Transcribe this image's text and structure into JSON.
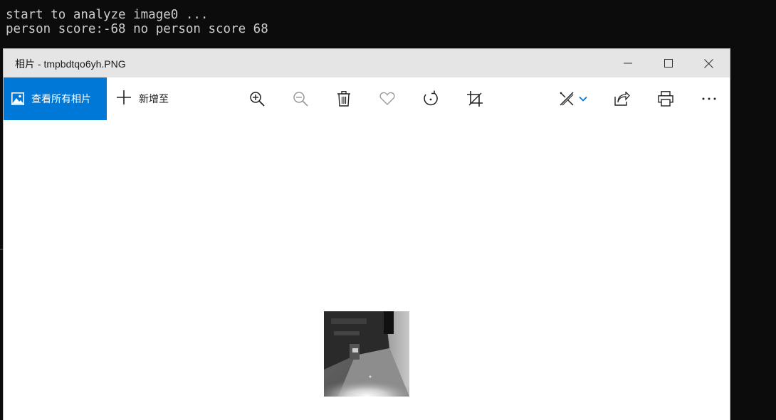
{
  "console": {
    "lines": [
      "start to analyze image0 ...",
      "person score:-68 no person score 68"
    ]
  },
  "window": {
    "title": "相片 - tmpbdtqo6yh.PNG",
    "controls": {
      "minimize_icon": "minimize-icon",
      "maximize_icon": "maximize-icon",
      "close_icon": "close-icon"
    }
  },
  "toolbar": {
    "view_all_label": "查看所有相片",
    "add_to_label": "新增至",
    "buttons": [
      "zoom-in-icon",
      "zoom-out-icon",
      "delete-icon",
      "favorite-icon",
      "rotate-icon",
      "crop-icon",
      "edit-icon",
      "share-icon",
      "print-icon",
      "more-icon"
    ],
    "accent_color": "#0078d7"
  },
  "photo": {
    "description_icon": "grayscale-photo"
  }
}
